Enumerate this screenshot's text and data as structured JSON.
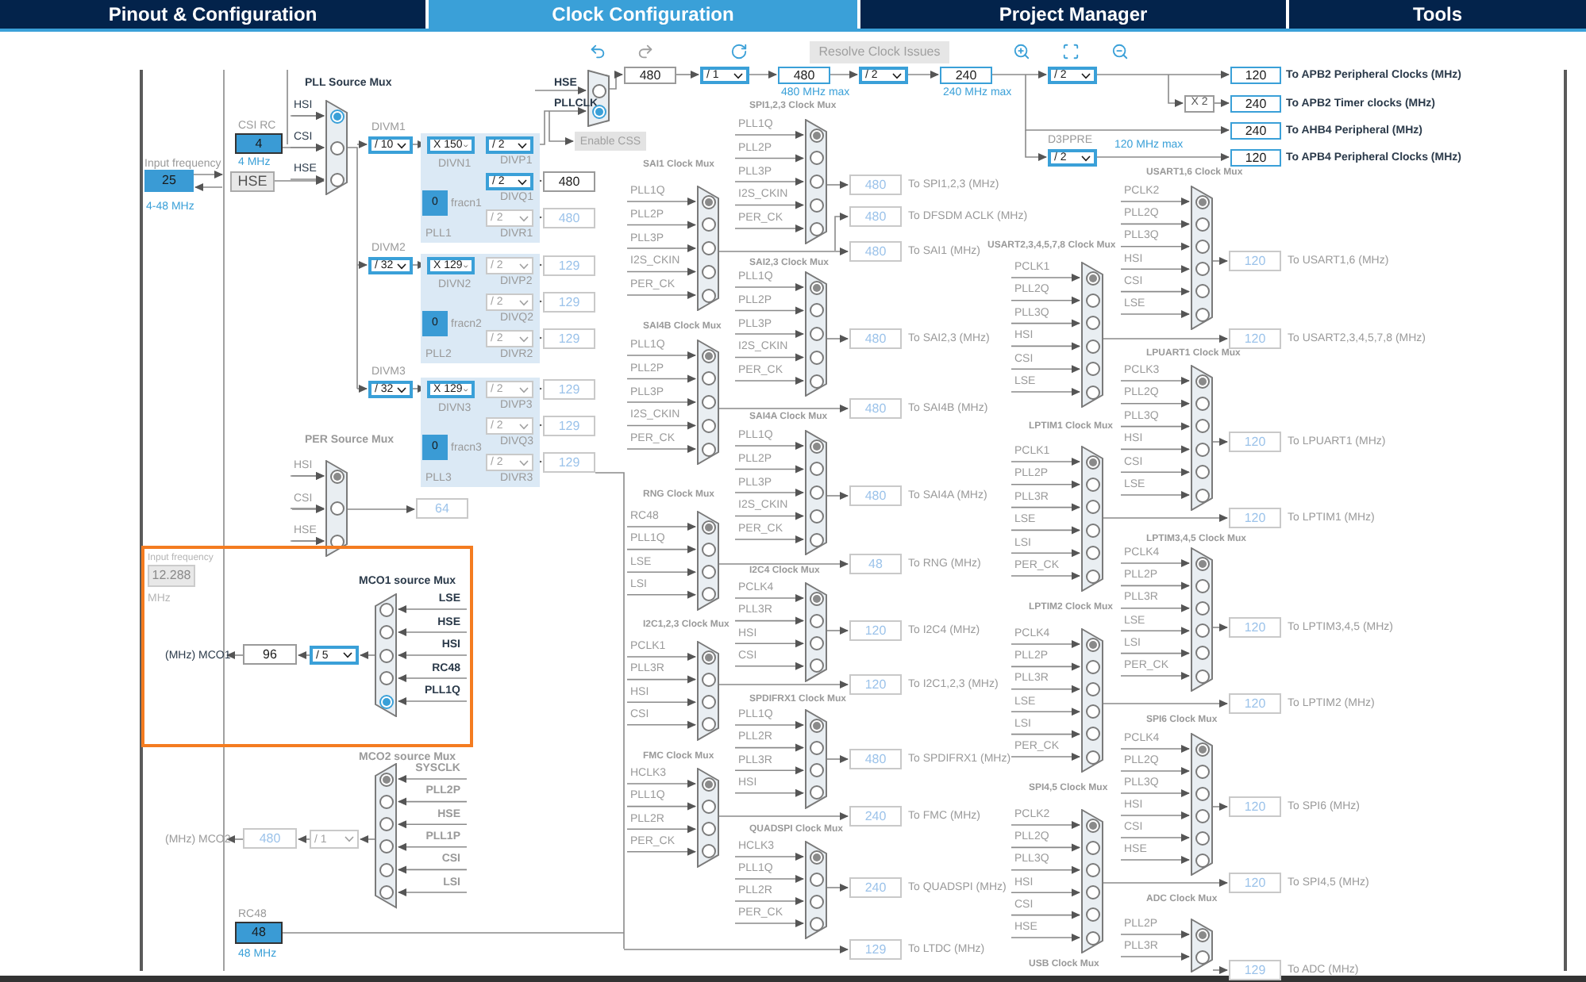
{
  "tabs": [
    {
      "label": "Pinout & Configuration",
      "selected": false
    },
    {
      "label": "Clock Configuration",
      "selected": true
    },
    {
      "label": "Project Manager",
      "selected": false
    },
    {
      "label": "Tools",
      "selected": false
    }
  ],
  "resolve_button": {
    "label": "Resolve Clock Issues",
    "disabled": true
  },
  "hse_input": {
    "label": "Input frequency",
    "value": "25",
    "range": "4-48 MHz",
    "source": "HSE"
  },
  "csi_rc": {
    "label": "CSI RC",
    "value": "4",
    "frequency": "4 MHz"
  },
  "rc48": {
    "label": "RC48",
    "value": "48",
    "frequency": "48 MHz"
  },
  "lse_input": {
    "label": "Input frequency",
    "value": "12.288",
    "unit": "MHz",
    "disabled": true
  },
  "plls": [
    {
      "name": "PLL1",
      "divm_label": "DIVM1",
      "divm": "/ 10",
      "divn": "X 150",
      "divn_label": "DIVN1",
      "fracn": "0",
      "fracn_label": "fracn1",
      "dividers": [
        {
          "label": "DIVP1",
          "value": "/ 2",
          "enabled": true
        },
        {
          "label": "DIVQ1",
          "value": "/ 2",
          "enabled": true,
          "output": "480"
        },
        {
          "label": "DIVR1",
          "value": "/ 2",
          "enabled": false,
          "output": "480"
        }
      ]
    },
    {
      "name": "PLL2",
      "divm_label": "DIVM2",
      "divm": "/ 32",
      "divn": "X 129",
      "divn_label": "DIVN2",
      "fracn": "0",
      "fracn_label": "fracn2",
      "dividers": [
        {
          "label": "DIVP2",
          "value": "/ 2",
          "enabled": false,
          "output": "129"
        },
        {
          "label": "DIVQ2",
          "value": "/ 2",
          "enabled": false,
          "output": "129"
        },
        {
          "label": "DIVR2",
          "value": "/ 2",
          "enabled": false,
          "output": "129"
        }
      ]
    },
    {
      "name": "PLL3",
      "divm_label": "DIVM3",
      "divm": "/ 32",
      "divn": "X 129",
      "divn_label": "DIVN3",
      "fracn": "0",
      "fracn_label": "fracn3",
      "dividers": [
        {
          "label": "DIVP3",
          "value": "/ 2",
          "enabled": false,
          "output": "129"
        },
        {
          "label": "DIVQ3",
          "value": "/ 2",
          "enabled": false,
          "output": "129"
        },
        {
          "label": "DIVR3",
          "value": "/ 2",
          "enabled": false,
          "output": "129"
        }
      ]
    }
  ],
  "per_output": "64",
  "system_mux": {
    "inputs": [
      {
        "label": "HSE",
        "selected": false
      },
      {
        "label": "PLLCLK",
        "selected": true
      }
    ],
    "css_button": {
      "label": "Enable CSS",
      "disabled": true
    }
  },
  "top_chain": [
    {
      "kind": "box",
      "value": "480"
    },
    {
      "kind": "dropdown",
      "value": "/ 1"
    },
    {
      "kind": "box",
      "value": "480",
      "note": "480 MHz max"
    },
    {
      "kind": "dropdown",
      "value": "/ 2"
    },
    {
      "kind": "box",
      "value": "240",
      "note": "240 MHz max"
    },
    {
      "kind": "dropdown",
      "value": "/ 2"
    }
  ],
  "d3ppre": {
    "label": "D3PPRE",
    "value": "/ 2",
    "note": "120 MHz max"
  },
  "timer_multiplier": "X 2",
  "peripheral_outputs": [
    {
      "value": "120",
      "label": "To APB2 Peripheral Clocks (MHz)"
    },
    {
      "value": "240",
      "label": "To APB2 Timer clocks (MHz)"
    },
    {
      "value": "240",
      "label": "To AHB4 Peripheral (MHz)"
    },
    {
      "value": "120",
      "label": "To APB4 Peripheral Clocks (MHz)"
    }
  ],
  "mco": [
    {
      "title": "MCO1 source Mux",
      "enabled": true,
      "inputs": [
        {
          "label": "LSE",
          "selected": false
        },
        {
          "label": "HSE",
          "selected": false
        },
        {
          "label": "HSI",
          "selected": false
        },
        {
          "label": "RC48",
          "selected": false
        },
        {
          "label": "PLL1Q",
          "selected": true
        }
      ],
      "divider": "/ 5",
      "output": "96",
      "label": "(MHz) MCO1"
    },
    {
      "title": "MCO2 source Mux",
      "enabled": false,
      "inputs": [
        {
          "label": "SYSCLK",
          "selected": true
        },
        {
          "label": "PLL2P",
          "selected": false
        },
        {
          "label": "HSE",
          "selected": false
        },
        {
          "label": "PLL1P",
          "selected": false
        },
        {
          "label": "CSI",
          "selected": false
        },
        {
          "label": "LSI",
          "selected": false
        }
      ],
      "divider": "/ 1",
      "output": "480",
      "label": "(MHz) MCO2"
    }
  ],
  "muxes": [
    {
      "title": "PLL Source Mux",
      "enabled": true,
      "inputs": [
        {
          "label": "HSI",
          "selected": true
        },
        {
          "label": "CSI",
          "selected": false
        },
        {
          "label": "HSE",
          "selected": false
        }
      ]
    },
    {
      "title": "PER Source Mux",
      "enabled": false,
      "inputs": [
        {
          "label": "HSI",
          "selected": true
        },
        {
          "label": "CSI",
          "selected": false
        },
        {
          "label": "HSE",
          "selected": false
        }
      ]
    },
    {
      "title": "SPI1,2,3 Clock Mux",
      "enabled": false,
      "inputs": [
        {
          "label": "PLL1Q",
          "selected": true
        },
        {
          "label": "PLL2P",
          "selected": false
        },
        {
          "label": "PLL3P",
          "selected": false
        },
        {
          "label": "I2S_CKIN",
          "selected": false
        },
        {
          "label": "PER_CK",
          "selected": false
        }
      ]
    },
    {
      "title": "SAI1 Clock Mux",
      "enabled": false,
      "inputs": [
        {
          "label": "PLL1Q",
          "selected": true
        },
        {
          "label": "PLL2P",
          "selected": false
        },
        {
          "label": "PLL3P",
          "selected": false
        },
        {
          "label": "I2S_CKIN",
          "selected": false
        },
        {
          "label": "PER_CK",
          "selected": false
        }
      ]
    },
    {
      "title": "SAI2,3 Clock Mux",
      "enabled": false,
      "inputs": [
        {
          "label": "PLL1Q",
          "selected": true
        },
        {
          "label": "PLL2P",
          "selected": false
        },
        {
          "label": "PLL3P",
          "selected": false
        },
        {
          "label": "I2S_CKIN",
          "selected": false
        },
        {
          "label": "PER_CK",
          "selected": false
        }
      ]
    },
    {
      "title": "SAI4B Clock Mux",
      "enabled": false,
      "inputs": [
        {
          "label": "PLL1Q",
          "selected": true
        },
        {
          "label": "PLL2P",
          "selected": false
        },
        {
          "label": "PLL3P",
          "selected": false
        },
        {
          "label": "I2S_CKIN",
          "selected": false
        },
        {
          "label": "PER_CK",
          "selected": false
        }
      ]
    },
    {
      "title": "SAI4A Clock Mux",
      "enabled": false,
      "inputs": [
        {
          "label": "PLL1Q",
          "selected": true
        },
        {
          "label": "PLL2P",
          "selected": false
        },
        {
          "label": "PLL3P",
          "selected": false
        },
        {
          "label": "I2S_CKIN",
          "selected": false
        },
        {
          "label": "PER_CK",
          "selected": false
        }
      ]
    },
    {
      "title": "RNG Clock Mux",
      "enabled": false,
      "inputs": [
        {
          "label": "RC48",
          "selected": true
        },
        {
          "label": "PLL1Q",
          "selected": false
        },
        {
          "label": "LSE",
          "selected": false
        },
        {
          "label": "LSI",
          "selected": false
        }
      ]
    },
    {
      "title": "I2C4 Clock Mux",
      "enabled": false,
      "inputs": [
        {
          "label": "PCLK4",
          "selected": true
        },
        {
          "label": "PLL3R",
          "selected": false
        },
        {
          "label": "HSI",
          "selected": false
        },
        {
          "label": "CSI",
          "selected": false
        }
      ]
    },
    {
      "title": "I2C1,2,3 Clock Mux",
      "enabled": false,
      "inputs": [
        {
          "label": "PCLK1",
          "selected": true
        },
        {
          "label": "PLL3R",
          "selected": false
        },
        {
          "label": "HSI",
          "selected": false
        },
        {
          "label": "CSI",
          "selected": false
        }
      ]
    },
    {
      "title": "SPDIFRX1 Clock Mux",
      "enabled": false,
      "inputs": [
        {
          "label": "PLL1Q",
          "selected": true
        },
        {
          "label": "PLL2R",
          "selected": false
        },
        {
          "label": "PLL3R",
          "selected": false
        },
        {
          "label": "HSI",
          "selected": false
        }
      ]
    },
    {
      "title": "FMC Clock Mux",
      "enabled": false,
      "inputs": [
        {
          "label": "HCLK3",
          "selected": true
        },
        {
          "label": "PLL1Q",
          "selected": false
        },
        {
          "label": "PLL2R",
          "selected": false
        },
        {
          "label": "PER_CK",
          "selected": false
        }
      ]
    },
    {
      "title": "QUADSPI Clock Mux",
      "enabled": false,
      "inputs": [
        {
          "label": "HCLK3",
          "selected": true
        },
        {
          "label": "PLL1Q",
          "selected": false
        },
        {
          "label": "PLL2R",
          "selected": false
        },
        {
          "label": "PER_CK",
          "selected": false
        }
      ]
    },
    {
      "title": "USART1,6 Clock Mux",
      "enabled": false,
      "inputs": [
        {
          "label": "PCLK2",
          "selected": true
        },
        {
          "label": "PLL2Q",
          "selected": false
        },
        {
          "label": "PLL3Q",
          "selected": false
        },
        {
          "label": "HSI",
          "selected": false
        },
        {
          "label": "CSI",
          "selected": false
        },
        {
          "label": "LSE",
          "selected": false
        }
      ]
    },
    {
      "title": "USART2,3,4,5,7,8 Clock Mux",
      "enabled": false,
      "inputs": [
        {
          "label": "PCLK1",
          "selected": true
        },
        {
          "label": "PLL2Q",
          "selected": false
        },
        {
          "label": "PLL3Q",
          "selected": false
        },
        {
          "label": "HSI",
          "selected": false
        },
        {
          "label": "CSI",
          "selected": false
        },
        {
          "label": "LSE",
          "selected": false
        }
      ]
    },
    {
      "title": "LPUART1 Clock Mux",
      "enabled": false,
      "inputs": [
        {
          "label": "PCLK3",
          "selected": true
        },
        {
          "label": "PLL2Q",
          "selected": false
        },
        {
          "label": "PLL3Q",
          "selected": false
        },
        {
          "label": "HSI",
          "selected": false
        },
        {
          "label": "CSI",
          "selected": false
        },
        {
          "label": "LSE",
          "selected": false
        }
      ]
    },
    {
      "title": "LPTIM1 Clock Mux",
      "enabled": false,
      "inputs": [
        {
          "label": "PCLK1",
          "selected": true
        },
        {
          "label": "PLL2P",
          "selected": false
        },
        {
          "label": "PLL3R",
          "selected": false
        },
        {
          "label": "LSE",
          "selected": false
        },
        {
          "label": "LSI",
          "selected": false
        },
        {
          "label": "PER_CK",
          "selected": false
        }
      ]
    },
    {
      "title": "LPTIM3,4,5 Clock Mux",
      "enabled": false,
      "inputs": [
        {
          "label": "PCLK4",
          "selected": true
        },
        {
          "label": "PLL2P",
          "selected": false
        },
        {
          "label": "PLL3R",
          "selected": false
        },
        {
          "label": "LSE",
          "selected": false
        },
        {
          "label": "LSI",
          "selected": false
        },
        {
          "label": "PER_CK",
          "selected": false
        }
      ]
    },
    {
      "title": "LPTIM2 Clock Mux",
      "enabled": false,
      "inputs": [
        {
          "label": "PCLK4",
          "selected": true
        },
        {
          "label": "PLL2P",
          "selected": false
        },
        {
          "label": "PLL3R",
          "selected": false
        },
        {
          "label": "LSE",
          "selected": false
        },
        {
          "label": "LSI",
          "selected": false
        },
        {
          "label": "PER_CK",
          "selected": false
        }
      ]
    },
    {
      "title": "SPI6 Clock Mux",
      "enabled": false,
      "inputs": [
        {
          "label": "PCLK4",
          "selected": true
        },
        {
          "label": "PLL2Q",
          "selected": false
        },
        {
          "label": "PLL3Q",
          "selected": false
        },
        {
          "label": "HSI",
          "selected": false
        },
        {
          "label": "CSI",
          "selected": false
        },
        {
          "label": "HSE",
          "selected": false
        }
      ]
    },
    {
      "title": "SPI4,5 Clock Mux",
      "enabled": false,
      "inputs": [
        {
          "label": "PCLK2",
          "selected": true
        },
        {
          "label": "PLL2Q",
          "selected": false
        },
        {
          "label": "PLL3Q",
          "selected": false
        },
        {
          "label": "HSI",
          "selected": false
        },
        {
          "label": "CSI",
          "selected": false
        },
        {
          "label": "HSE",
          "selected": false
        }
      ]
    },
    {
      "title": "ADC Clock Mux",
      "enabled": false,
      "inputs": [
        {
          "label": "PLL2P",
          "selected": true
        },
        {
          "label": "PLL3R",
          "selected": false
        }
      ]
    },
    {
      "title": "USB Clock Mux",
      "enabled": false
    }
  ],
  "outputs": [
    {
      "value": "480",
      "label": "To SPI1,2,3 (MHz)",
      "enabled": false
    },
    {
      "value": "480",
      "label": "To DFSDM ACLK (MHz)",
      "enabled": false
    },
    {
      "value": "480",
      "label": "To SAI1 (MHz)",
      "enabled": false
    },
    {
      "value": "480",
      "label": "To SAI2,3 (MHz)",
      "enabled": false
    },
    {
      "value": "480",
      "label": "To SAI4B (MHz)",
      "enabled": false
    },
    {
      "value": "480",
      "label": "To SAI4A (MHz)",
      "enabled": false
    },
    {
      "value": "48",
      "label": "To RNG (MHz)",
      "enabled": false
    },
    {
      "value": "120",
      "label": "To I2C4 (MHz)",
      "enabled": false
    },
    {
      "value": "120",
      "label": "To I2C1,2,3 (MHz)",
      "enabled": false
    },
    {
      "value": "480",
      "label": "To SPDIFRX1 (MHz)",
      "enabled": false
    },
    {
      "value": "240",
      "label": "To FMC (MHz)",
      "enabled": false
    },
    {
      "value": "240",
      "label": "To QUADSPI (MHz)",
      "enabled": false
    },
    {
      "value": "129",
      "label": "To LTDC (MHz)",
      "enabled": false
    },
    {
      "value": "120",
      "label": "To USART1,6 (MHz)",
      "enabled": false
    },
    {
      "value": "120",
      "label": "To USART2,3,4,5,7,8 (MHz)",
      "enabled": false
    },
    {
      "value": "120",
      "label": "To LPUART1 (MHz)",
      "enabled": false
    },
    {
      "value": "120",
      "label": "To LPTIM1 (MHz)",
      "enabled": false
    },
    {
      "value": "120",
      "label": "To LPTIM3,4,5 (MHz)",
      "enabled": false
    },
    {
      "value": "120",
      "label": "To LPTIM2 (MHz)",
      "enabled": false
    },
    {
      "value": "120",
      "label": "To SPI6 (MHz)",
      "enabled": false
    },
    {
      "value": "120",
      "label": "To SPI4,5 (MHz)",
      "enabled": false
    },
    {
      "value": "129",
      "label": "To ADC (MHz)",
      "enabled": false
    }
  ]
}
